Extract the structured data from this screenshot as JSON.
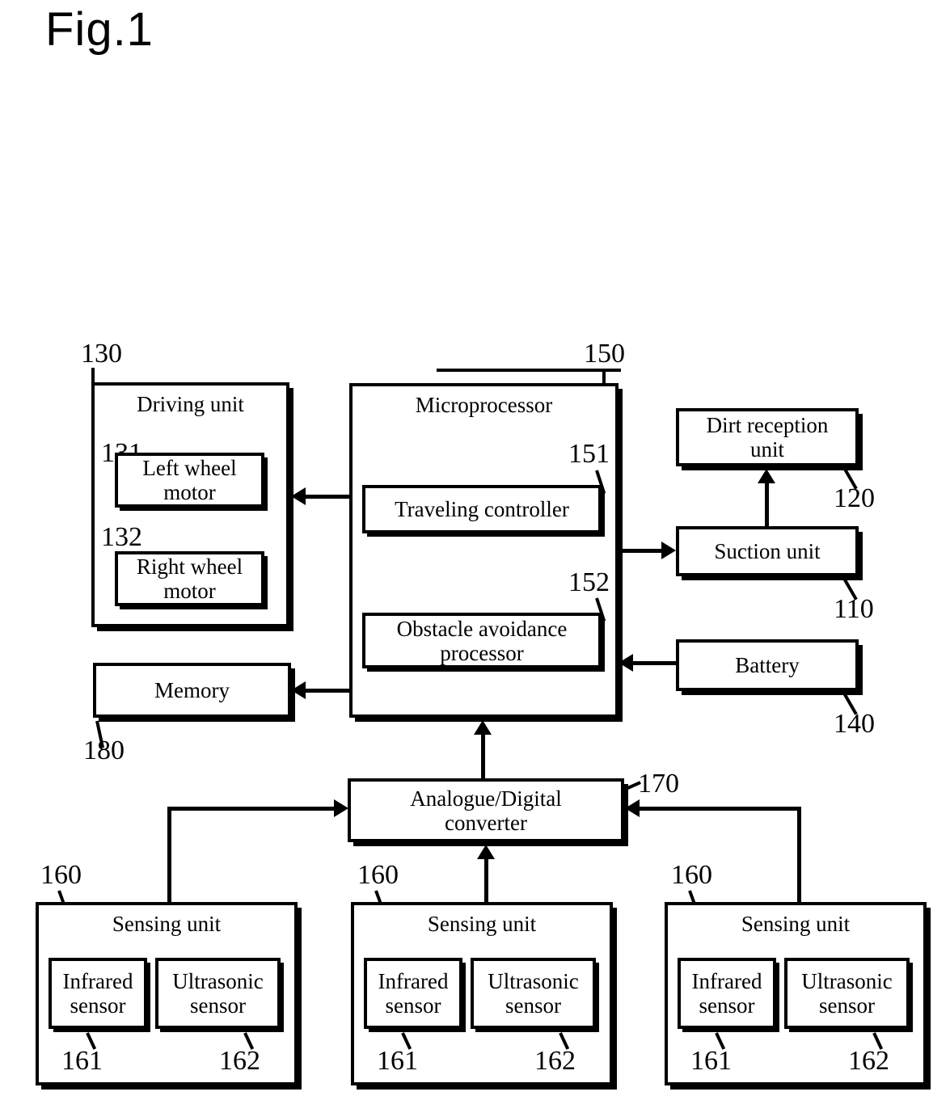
{
  "figure": {
    "title": "Fig.1"
  },
  "blocks": {
    "driving_unit": {
      "label": "Driving unit",
      "ref": "130",
      "children": {
        "left_wheel_motor": {
          "label": "Left wheel\nmotor",
          "ref": "131"
        },
        "right_wheel_motor": {
          "label": "Right wheel\nmotor",
          "ref": "132"
        }
      }
    },
    "microprocessor": {
      "label": "Microprocessor",
      "ref": "150",
      "children": {
        "traveling_controller": {
          "label": "Traveling controller",
          "ref": "151"
        },
        "obstacle_avoidance_processor": {
          "label": "Obstacle avoidance\nprocessor",
          "ref": "152"
        }
      }
    },
    "dirt_reception_unit": {
      "label": "Dirt reception\nunit",
      "ref": "120"
    },
    "suction_unit": {
      "label": "Suction unit",
      "ref": "110"
    },
    "battery": {
      "label": "Battery",
      "ref": "140"
    },
    "memory": {
      "label": "Memory",
      "ref": "180"
    },
    "ad_converter": {
      "label": "Analogue/Digital\nconverter",
      "ref": "170"
    },
    "sensing_unit_left": {
      "label": "Sensing unit",
      "ref": "160",
      "children": {
        "infrared_sensor": {
          "label": "Infrared\nsensor",
          "ref": "161"
        },
        "ultrasonic_sensor": {
          "label": "Ultrasonic\nsensor",
          "ref": "162"
        }
      }
    },
    "sensing_unit_center": {
      "label": "Sensing unit",
      "ref": "160",
      "children": {
        "infrared_sensor": {
          "label": "Infrared\nsensor",
          "ref": "161"
        },
        "ultrasonic_sensor": {
          "label": "Ultrasonic\nsensor",
          "ref": "162"
        }
      }
    },
    "sensing_unit_right": {
      "label": "Sensing unit",
      "ref": "160",
      "children": {
        "infrared_sensor": {
          "label": "Infrared\nsensor",
          "ref": "161"
        },
        "ultrasonic_sensor": {
          "label": "Ultrasonic\nsensor",
          "ref": "162"
        }
      }
    }
  },
  "colors": {
    "stroke": "#000000",
    "background": "#ffffff"
  }
}
